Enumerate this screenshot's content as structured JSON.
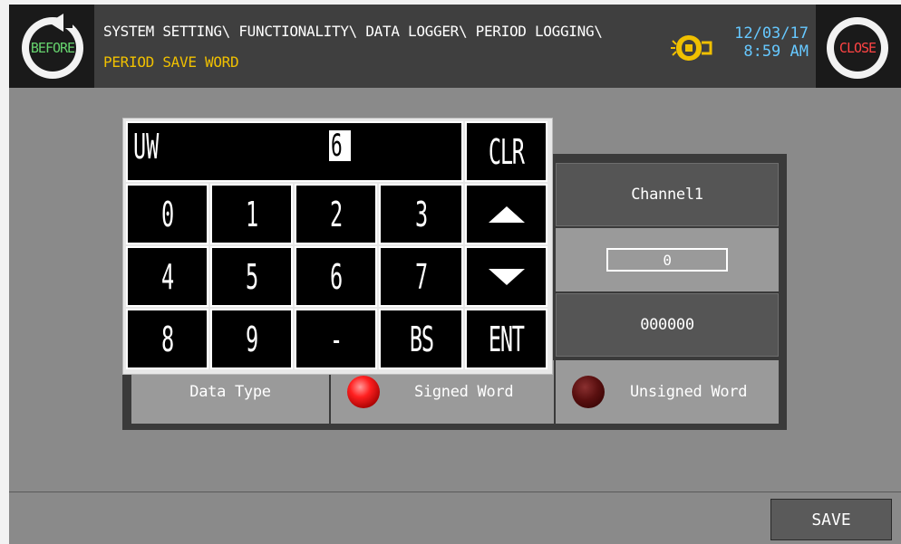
{
  "header": {
    "before_label": "BEFORE",
    "close_label": "CLOSE",
    "path": "SYSTEM SETTING\\ FUNCTIONALITY\\ DATA LOGGER\\ PERIOD LOGGING\\",
    "subtitle": "PERIOD SAVE WORD",
    "date": "12/03/17",
    "time": "8:59 AM",
    "colors": {
      "before": "#66d36e",
      "close": "#ff4444",
      "path": "#ffffff",
      "subtitle": "#f0c000",
      "datetime": "#66c8ff"
    }
  },
  "keypad": {
    "register": "UW",
    "input_value": "6",
    "clr": "CLR",
    "keys_row1": [
      "0",
      "1",
      "2",
      "3"
    ],
    "keys_row2": [
      "4",
      "5",
      "6",
      "7"
    ],
    "keys_row3": [
      "8",
      "9",
      "-",
      "BS"
    ],
    "enter": "ENT",
    "up_icon": "arrow-up-icon",
    "down_icon": "arrow-down-icon"
  },
  "table": {
    "channel_header": "Channel1",
    "value": "0",
    "address": "000000",
    "data_type_label": "Data Type",
    "signed_label": "Signed Word",
    "unsigned_label": "Unsigned Word",
    "selected": "Signed Word"
  },
  "footer": {
    "save_label": "SAVE"
  }
}
